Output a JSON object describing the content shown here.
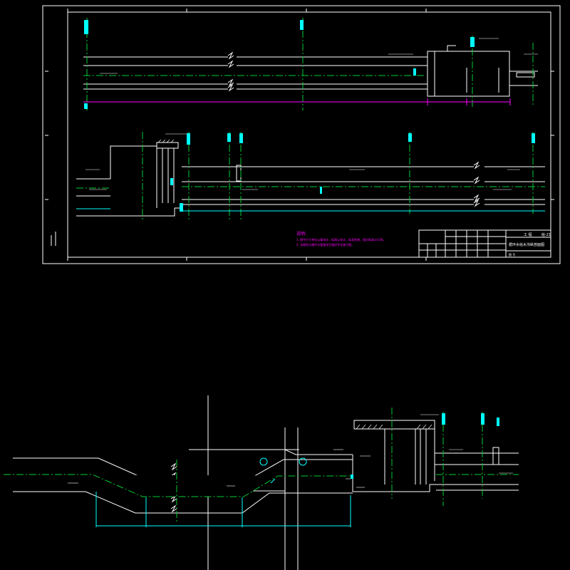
{
  "colors": {
    "background": "#000000",
    "line": "#ffffff",
    "center": "#00cc33",
    "dim": "#00ffff",
    "note": "#ff00ff",
    "yellow": "#ffff00"
  },
  "drawing": {
    "sheet": {
      "title_block": {
        "project_label": "工 程",
        "drawing_number": "给-21",
        "drawing_title": "循环水给水沟纵剖面图",
        "sheet_label": "图 号"
      },
      "notes": {
        "heading": "说明:",
        "lines": [
          "1. 图中尺寸单位以毫米计，标高以米计，标高系统，相对标高±0.00。",
          "2. 本图所示循环水管道详见相应专业施工图。"
        ]
      }
    },
    "lower_section": {
      "label": "2-2"
    }
  }
}
